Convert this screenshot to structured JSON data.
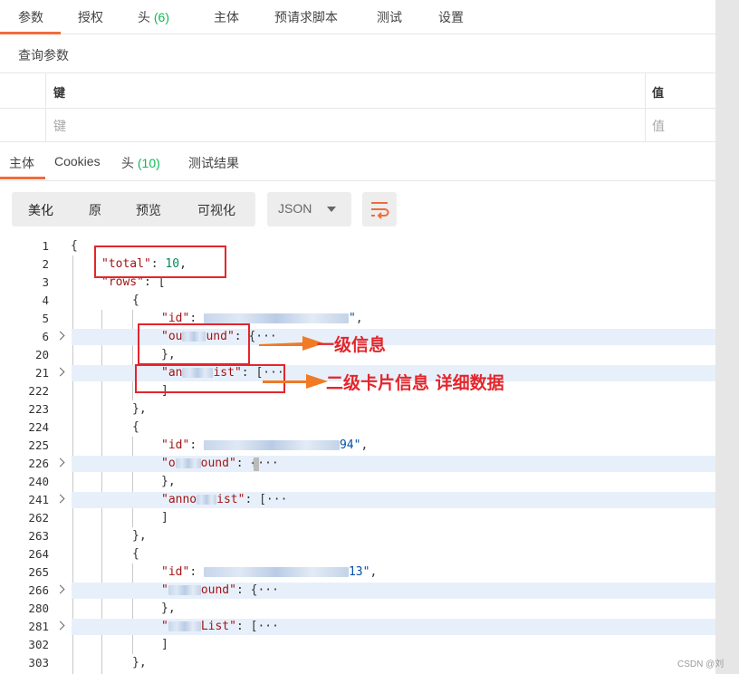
{
  "request_tabs": [
    {
      "label": "参数",
      "count": ""
    },
    {
      "label": "授权",
      "count": ""
    },
    {
      "label": "头",
      "count": "(6)"
    },
    {
      "label": "主体",
      "count": ""
    },
    {
      "label": "预请求脚本",
      "count": ""
    },
    {
      "label": "测试",
      "count": ""
    },
    {
      "label": "设置",
      "count": ""
    }
  ],
  "query_params": {
    "title": "查询参数",
    "key_header": "键",
    "value_header": "值",
    "key_placeholder": "键",
    "value_placeholder": "值"
  },
  "response_tabs": [
    {
      "label": "主体",
      "count": ""
    },
    {
      "label": "Cookies",
      "count": ""
    },
    {
      "label": "头",
      "count": "(10)"
    },
    {
      "label": "测试结果",
      "count": ""
    }
  ],
  "format_buttons": [
    "美化",
    "原",
    "预览",
    "可视化"
  ],
  "language_select": "JSON",
  "code_lines": [
    "1",
    "2",
    "3",
    "4",
    "5",
    "6",
    "20",
    "21",
    "222",
    "223",
    "224",
    "225",
    "226",
    "240",
    "241",
    "262",
    "263",
    "264",
    "265",
    "266",
    "280",
    "281",
    "302",
    "303"
  ],
  "code": {
    "total_key": "\"total\"",
    "total_value": "10",
    "rows_key": "\"rows\"",
    "id_key": "\"id\"",
    "ob1": "\"ou",
    "ob2": "und\"",
    "an1": "\"an",
    "an2": "ist\"",
    "ob3": "\"o",
    "ob4": "ound\"",
    "an3": "\"anno",
    "an4": "ist\"",
    "ob5": "\"",
    "ob6": "ound\"",
    "an5": "\"",
    "an6": "List\"",
    "id2_tail": "94\"",
    "id3_tail": "13\"",
    "id1_tail": "\""
  },
  "annotations": {
    "level1": "一级信息",
    "level2": "二级卡片信息 详细数据"
  },
  "colors": {
    "accent": "#f26b3a",
    "count_green": "#0cbb52",
    "annotation_red": "#e3262c",
    "highlight_row": "#e7f0fa"
  },
  "watermark": "CSDN @刘"
}
